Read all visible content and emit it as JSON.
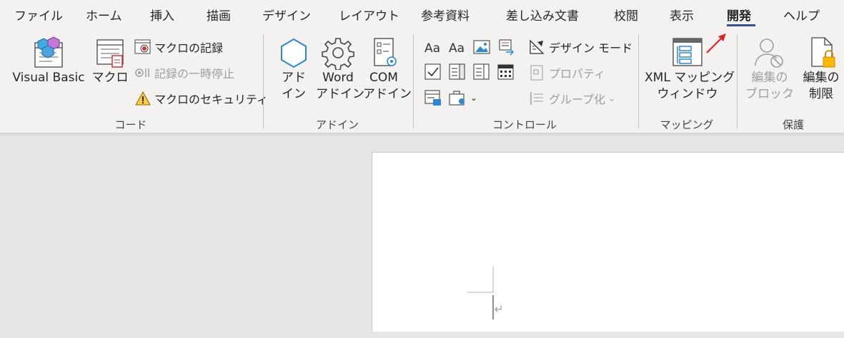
{
  "tabs": [
    "ファイル",
    "ホーム",
    "挿入",
    "描画",
    "デザイン",
    "レイアウト",
    "参考資料",
    "差し込み文書",
    "校閲",
    "表示",
    "開発",
    "ヘルプ"
  ],
  "active_tab": "開発",
  "groups": {
    "code": {
      "label": "コード",
      "visual_basic": "Visual Basic",
      "macro": "マクロ",
      "record_macro": "マクロの記録",
      "pause_recording": "記録の一時停止",
      "macro_security": "マクロのセキュリティ"
    },
    "addins": {
      "label": "アドイン",
      "addin": "アド\nイン",
      "word_addin": "Word\nアドイン",
      "com_addin": "COM\nアドイン"
    },
    "controls": {
      "label": "コントロール",
      "design_mode": "デザイン モード",
      "properties": "プロパティ",
      "group": "グループ化"
    },
    "mapping": {
      "label": "マッピング",
      "xml_mapping": "XML マッピング\nウィンドウ"
    },
    "protect": {
      "label": "保護",
      "block_authors": "編集の\nブロック",
      "restrict_editing": "編集の\n制限"
    }
  },
  "colors": {
    "accent": "#2b579a",
    "arrow": "#e02020",
    "ribbon_bg": "#f3f2f1",
    "doc_area_bg": "#e6e6e6"
  }
}
